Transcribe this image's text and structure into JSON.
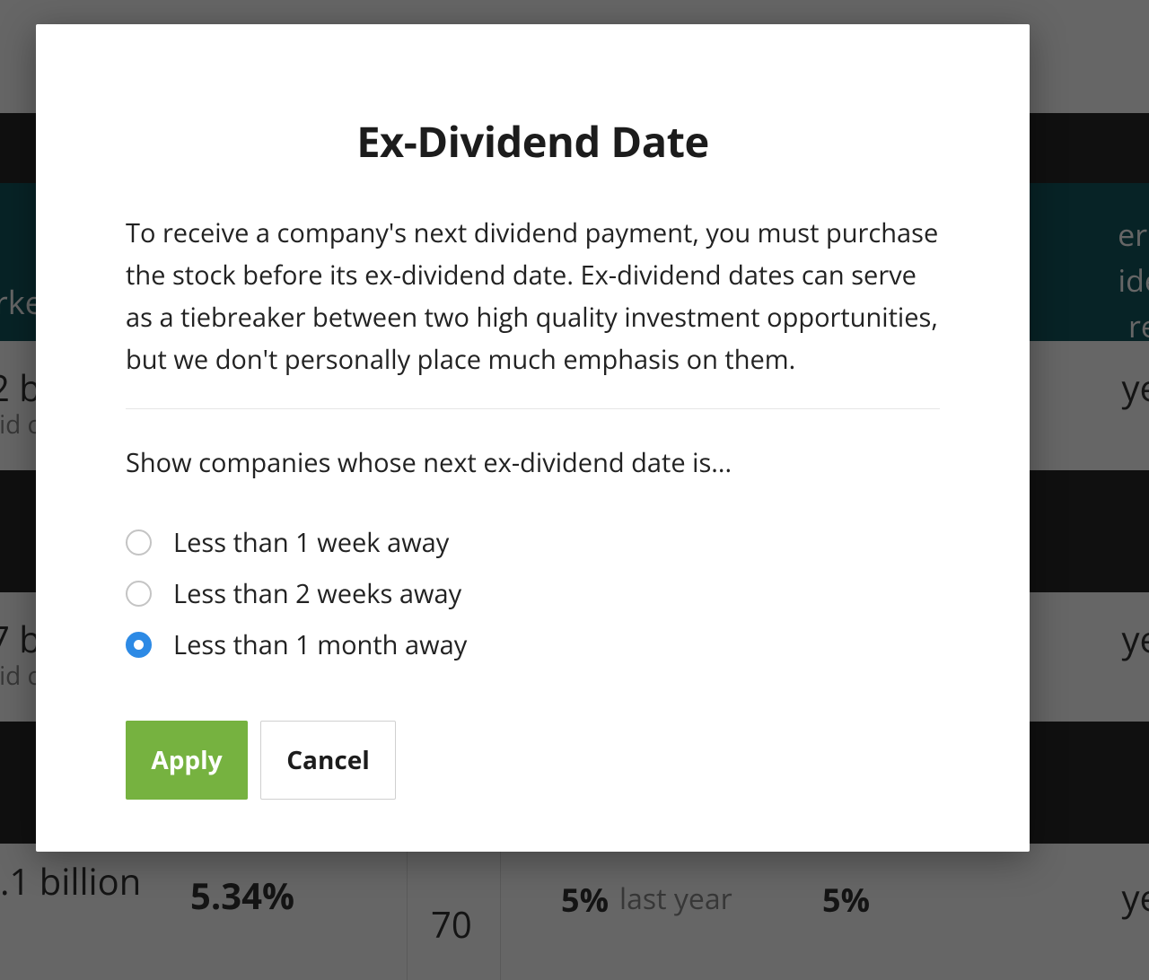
{
  "modal": {
    "title": "Ex-Dividend Date",
    "description": "To receive a company's next dividend payment, you must purchase the stock before its ex-dividend date. Ex-dividend dates can serve as a tiebreaker between two high quality investment opportunities, but we don't personally place much emphasis on them.",
    "filter_prompt": "Show companies whose next ex-dividend date is...",
    "options": [
      {
        "label": "Less than 1 week away",
        "selected": false
      },
      {
        "label": "Less than 2 weeks away",
        "selected": false
      },
      {
        "label": "Less than 1 month away",
        "selected": true
      }
    ],
    "apply_label": "Apply",
    "cancel_label": "Cancel"
  },
  "background": {
    "teal_left": "rke",
    "teal_right_1": "err",
    "teal_right_2": "ide",
    "teal_right_3": "re",
    "row1_left_top": "2 b",
    "row1_left_sub": "lid c",
    "row1_right": "ye",
    "row2_left_top": "7 b",
    "row2_left_sub": "lid c",
    "row2_right": "ye",
    "bottom_left": ".1 billion",
    "bottom_pct": "5.34%",
    "bottom_mid": "70",
    "bottom_5a": "5%",
    "bottom_5a_suffix": "last year",
    "bottom_5b": "5%",
    "bottom_right": "ye"
  }
}
